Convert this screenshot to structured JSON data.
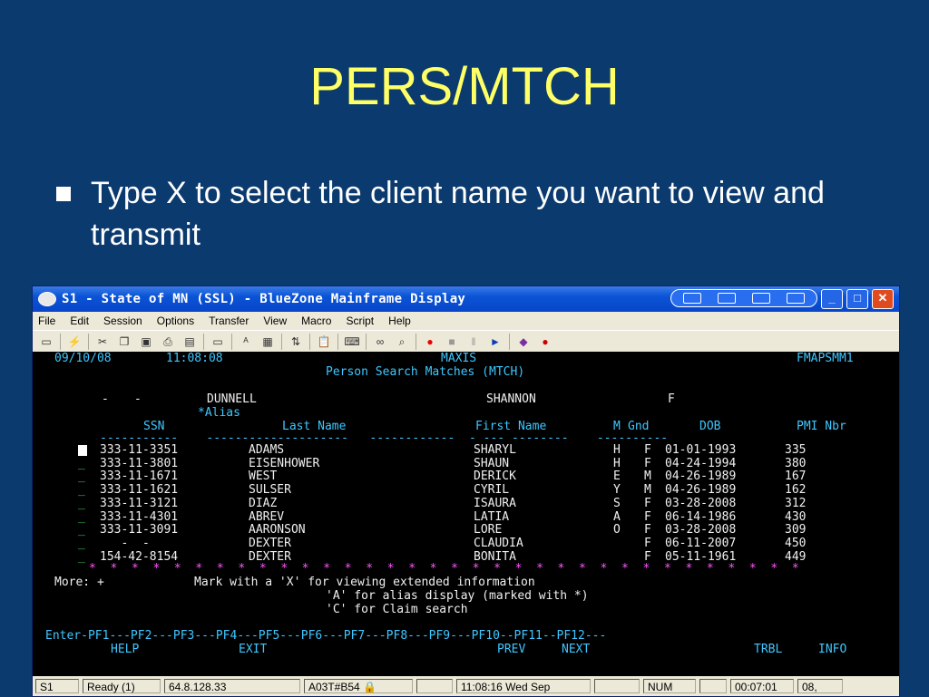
{
  "slide": {
    "title": "PERS/MTCH",
    "bullet": "Type X to select the client name you want to view and transmit"
  },
  "window": {
    "title": "S1 - State of MN (SSL) - BlueZone Mainframe Display",
    "menu": [
      "File",
      "Edit",
      "Session",
      "Options",
      "Transfer",
      "View",
      "Macro",
      "Script",
      "Help"
    ]
  },
  "terminal": {
    "date": "09/10/08",
    "time": "11:08:08",
    "system": "MAXIS",
    "screen_id": "FMAPSMM1",
    "screen_title": "Person Search Matches (MTCH)",
    "search": {
      "ssn_part1": "-",
      "ssn_part2": "-",
      "last": "DUNNELL",
      "first": "SHANNON",
      "gender": "F"
    },
    "alias_note": "*Alias",
    "headers": {
      "ssn": "SSN",
      "last": "Last Name",
      "first": "First Name",
      "m": "M",
      "gnd": "Gnd",
      "dob": "DOB",
      "pmi": "PMI Nbr"
    },
    "rows": [
      {
        "ssn": "333-11-3351",
        "last": "ADAMS",
        "first": "SHARYL",
        "m": "H",
        "gnd": "F",
        "dob": "01-01-1993",
        "pmi": "335"
      },
      {
        "ssn": "333-11-3801",
        "last": "EISENHOWER",
        "first": "SHAUN",
        "m": "H",
        "gnd": "F",
        "dob": "04-24-1994",
        "pmi": "380"
      },
      {
        "ssn": "333-11-1671",
        "last": "WEST",
        "first": "DERICK",
        "m": "E",
        "gnd": "M",
        "dob": "04-26-1989",
        "pmi": "167"
      },
      {
        "ssn": "333-11-1621",
        "last": "SULSER",
        "first": "CYRIL",
        "m": "Y",
        "gnd": "M",
        "dob": "04-26-1989",
        "pmi": "162"
      },
      {
        "ssn": "333-11-3121",
        "last": "DIAZ",
        "first": "ISAURA",
        "m": "S",
        "gnd": "F",
        "dob": "03-28-2008",
        "pmi": "312"
      },
      {
        "ssn": "333-11-4301",
        "last": "ABREV",
        "first": "LATIA",
        "m": "A",
        "gnd": "F",
        "dob": "06-14-1986",
        "pmi": "430"
      },
      {
        "ssn": "333-11-3091",
        "last": "AARONSON",
        "first": "LORE",
        "m": "O",
        "gnd": "F",
        "dob": "03-28-2008",
        "pmi": "309"
      },
      {
        "ssn": "   -  -",
        "last": "DEXTER",
        "first": "CLAUDIA",
        "m": "",
        "gnd": "F",
        "dob": "06-11-2007",
        "pmi": "450"
      },
      {
        "ssn": "154-42-8154",
        "last": "DEXTER",
        "first": "BONITA",
        "m": "",
        "gnd": "F",
        "dob": "05-11-1961",
        "pmi": "449"
      }
    ],
    "more": "More: +",
    "instructions": [
      "Mark with a 'X' for viewing extended information",
      "'A' for alias display (marked with *)",
      "'C' for Claim search"
    ],
    "pf_line": "Enter-PF1---PF2---PF3---PF4---PF5---PF6---PF7---PF8---PF9---PF10--PF11--PF12---",
    "pf_labels": {
      "help": "HELP",
      "exit": "EXIT",
      "prev": "PREV",
      "next": "NEXT",
      "trbl": "TRBL",
      "info": "INFO"
    }
  },
  "statusbar": {
    "session": "S1",
    "state": "Ready (1)",
    "ip": "64.8.128.33",
    "terminal": "A03T#B54",
    "clock": "11:08:16  Wed Sep",
    "num": "NUM",
    "elapsed": "00:07:01",
    "pos": "08,"
  }
}
